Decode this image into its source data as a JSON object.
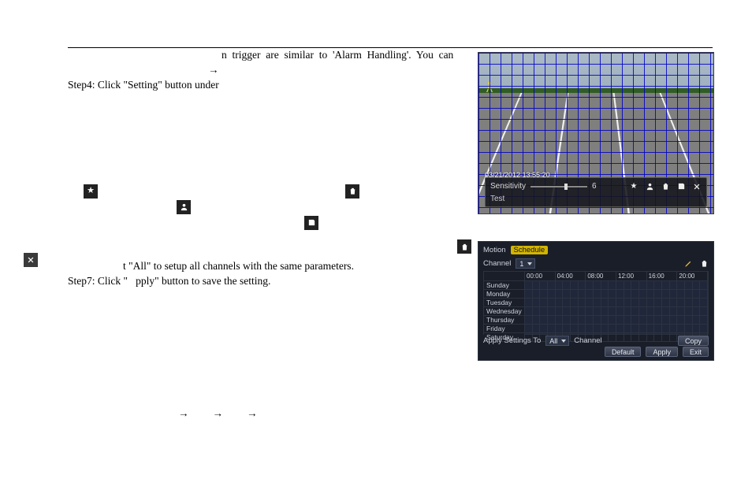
{
  "text": {
    "line1": "n  trigger  are  similar  to  'Alarm  Handling'.  You  can",
    "arrow1": "→",
    "step4": "Step4: Click \"Setting\" button under",
    "step6_all": "t \"All\" to setup all channels with the same parameters.",
    "step7": "Step7: Click \"   pply\" button to save the setting.",
    "arrowSeq": "→        →        →"
  },
  "area": {
    "timestamp": "03/21/2012  13:55:20",
    "sensitivity_label": "Sensitivity",
    "sensitivity_value": "6",
    "test_label": "Test",
    "icons": [
      "star-icon",
      "user-icon",
      "trash-icon",
      "save-icon",
      "close-icon"
    ]
  },
  "schedule": {
    "tab_motion": "Motion",
    "tab_schedule": "Schedule",
    "channel_label": "Channel",
    "channel_value": "1",
    "times": [
      "00:00",
      "04:00",
      "08:00",
      "12:00",
      "16:00",
      "20:00"
    ],
    "days": [
      "Sunday",
      "Monday",
      "Tuesday",
      "Wednesday",
      "Thursday",
      "Friday",
      "Saturday"
    ],
    "apply_to_label": "Apply Settings To",
    "apply_to_value": "All",
    "channel_word": "Channel",
    "copy_btn": "Copy",
    "default_btn": "Default",
    "apply_btn": "Apply",
    "exit_btn": "Exit"
  },
  "inline_icons": {
    "star": "★",
    "user": "◙",
    "trash": "🗑",
    "save": "💾",
    "close": "✕"
  }
}
